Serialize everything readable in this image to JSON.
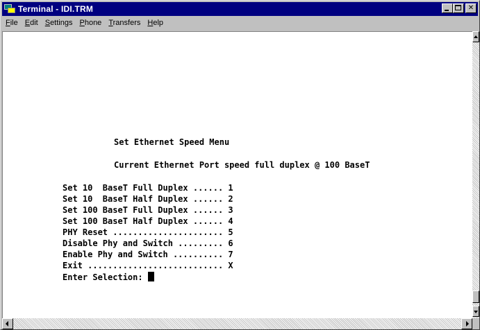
{
  "window": {
    "title": "Terminal - IDI.TRM",
    "minimize_glyph": "_",
    "maximize_glyph": "□",
    "close_glyph": "✕"
  },
  "menubar": {
    "items": [
      {
        "accel": "F",
        "rest": "ile"
      },
      {
        "accel": "E",
        "rest": "dit"
      },
      {
        "accel": "S",
        "rest": "ettings"
      },
      {
        "accel": "P",
        "rest": "hone"
      },
      {
        "accel": "T",
        "rest": "ransfers"
      },
      {
        "accel": "H",
        "rest": "elp"
      }
    ]
  },
  "terminal": {
    "menu_title": "Set Ethernet Speed Menu",
    "current_status": "Current Ethernet Port speed full duplex @ 100 BaseT",
    "options": [
      "Set 10  BaseT Full Duplex ...... 1",
      "Set 10  BaseT Half Duplex ...... 2",
      "Set 100 BaseT Full Duplex ...... 3",
      "Set 100 BaseT Half Duplex ...... 4",
      "PHY Reset ...................... 5",
      "Disable Phy and Switch ......... 6",
      "Enable Phy and Switch .......... 7",
      "Exit ........................... X"
    ],
    "prompt": "Enter Selection: "
  },
  "colors": {
    "titlebar": "#000080",
    "chrome": "#c0c0c0",
    "terminal_bg": "#ffffff",
    "terminal_text": "#000000"
  }
}
